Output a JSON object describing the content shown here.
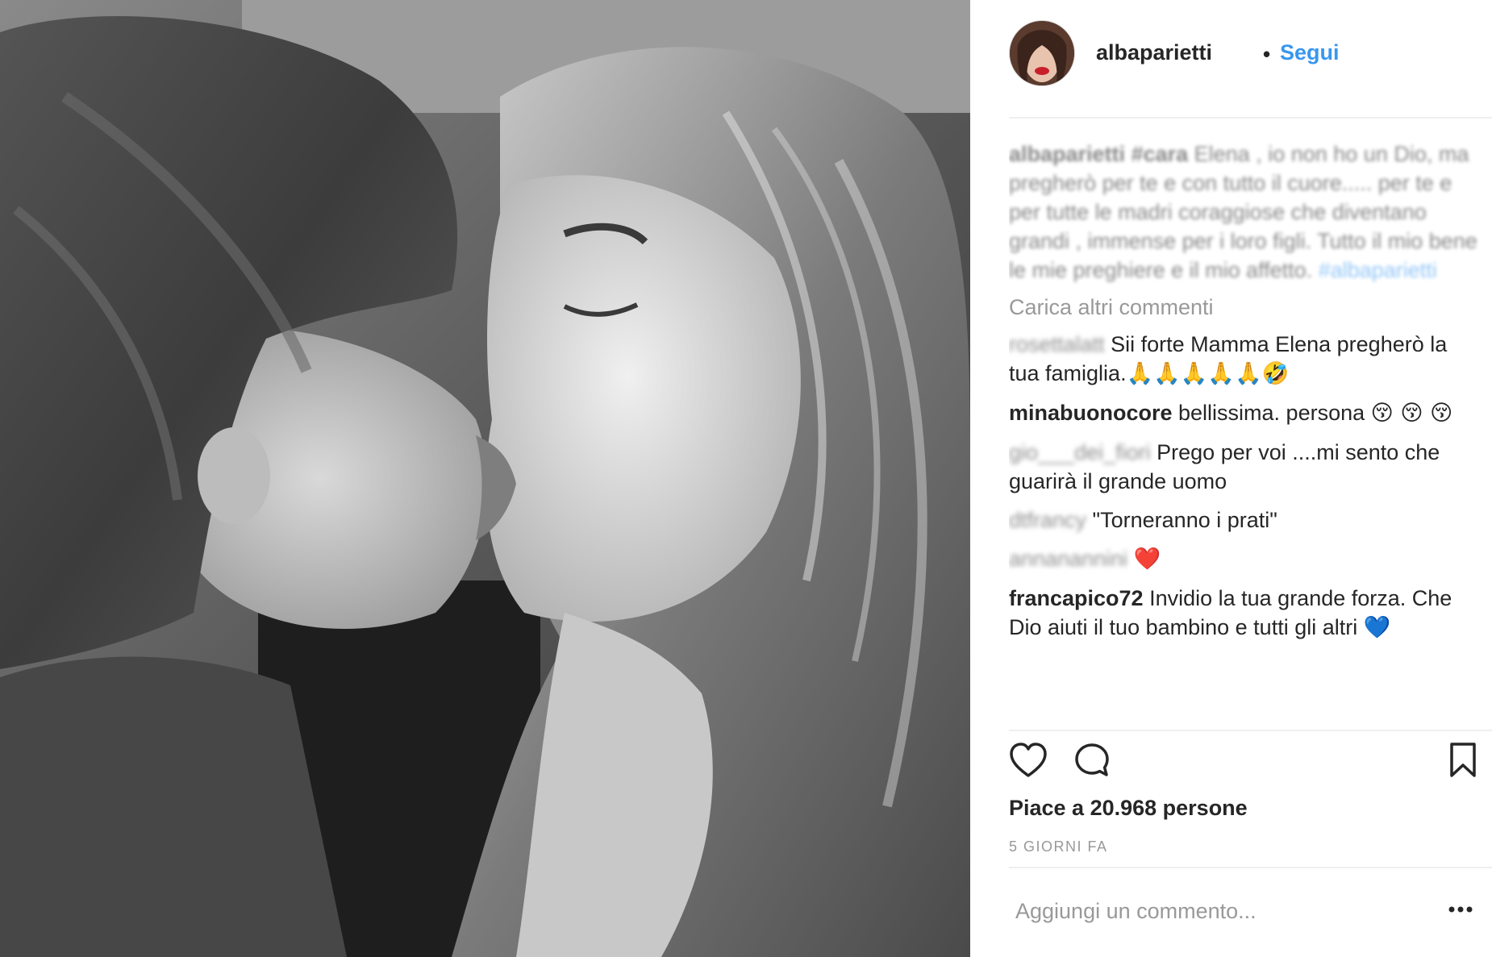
{
  "post": {
    "username": "albaparietti",
    "dot": "•",
    "follow_label": "Segui"
  },
  "caption": {
    "user": "albaparietti",
    "tag_cara": "#cara",
    "text_1": " Elena , io non ho un Dio, ma pregherò per te e con tutto il cuore..... per te e per tutte le madri coraggiose che diventano grandi , immense per i loro figli. Tutto il mio bene le mie preghiere e il mio affetto. ",
    "tag_end": "#albaparietti"
  },
  "load_more_label": "Carica altri commenti",
  "comments": [
    {
      "user": "rosettalatt",
      "text": " Sii forte Mamma Elena pregherò la tua famiglia.",
      "emoji": "🙏🙏🙏🙏🙏🤣"
    },
    {
      "user": "minabuonocore",
      "text": " bellissima. persona ",
      "emoji": "😚 😚 😚"
    },
    {
      "user": "gio___dei_fiori",
      "text": " Prego per voi ....mi sento che guarirà il grande uomo",
      "emoji": ""
    },
    {
      "user": "dtfrancy",
      "text": " \"Torneranno i prati\"",
      "emoji": ""
    },
    {
      "user": "annanannini",
      "text": " ",
      "emoji": "❤️"
    },
    {
      "user": "francapico72",
      "text": " Invidio la tua grande forza. Che Dio aiuti il tuo bambino e tutti gli altri ",
      "emoji": "💙"
    }
  ],
  "likes_label": "Piace a 20.968 persone",
  "timestamp": "5 GIORNI FA",
  "add_comment": {
    "placeholder": "Aggiungi un commento..."
  },
  "icons": {
    "like": "heart-icon",
    "comment": "comment-bubble-icon",
    "save": "bookmark-icon",
    "more": "more-options-icon"
  },
  "colors": {
    "link": "#3897f0",
    "muted": "#999999",
    "text": "#262626",
    "divider": "#efefef"
  }
}
